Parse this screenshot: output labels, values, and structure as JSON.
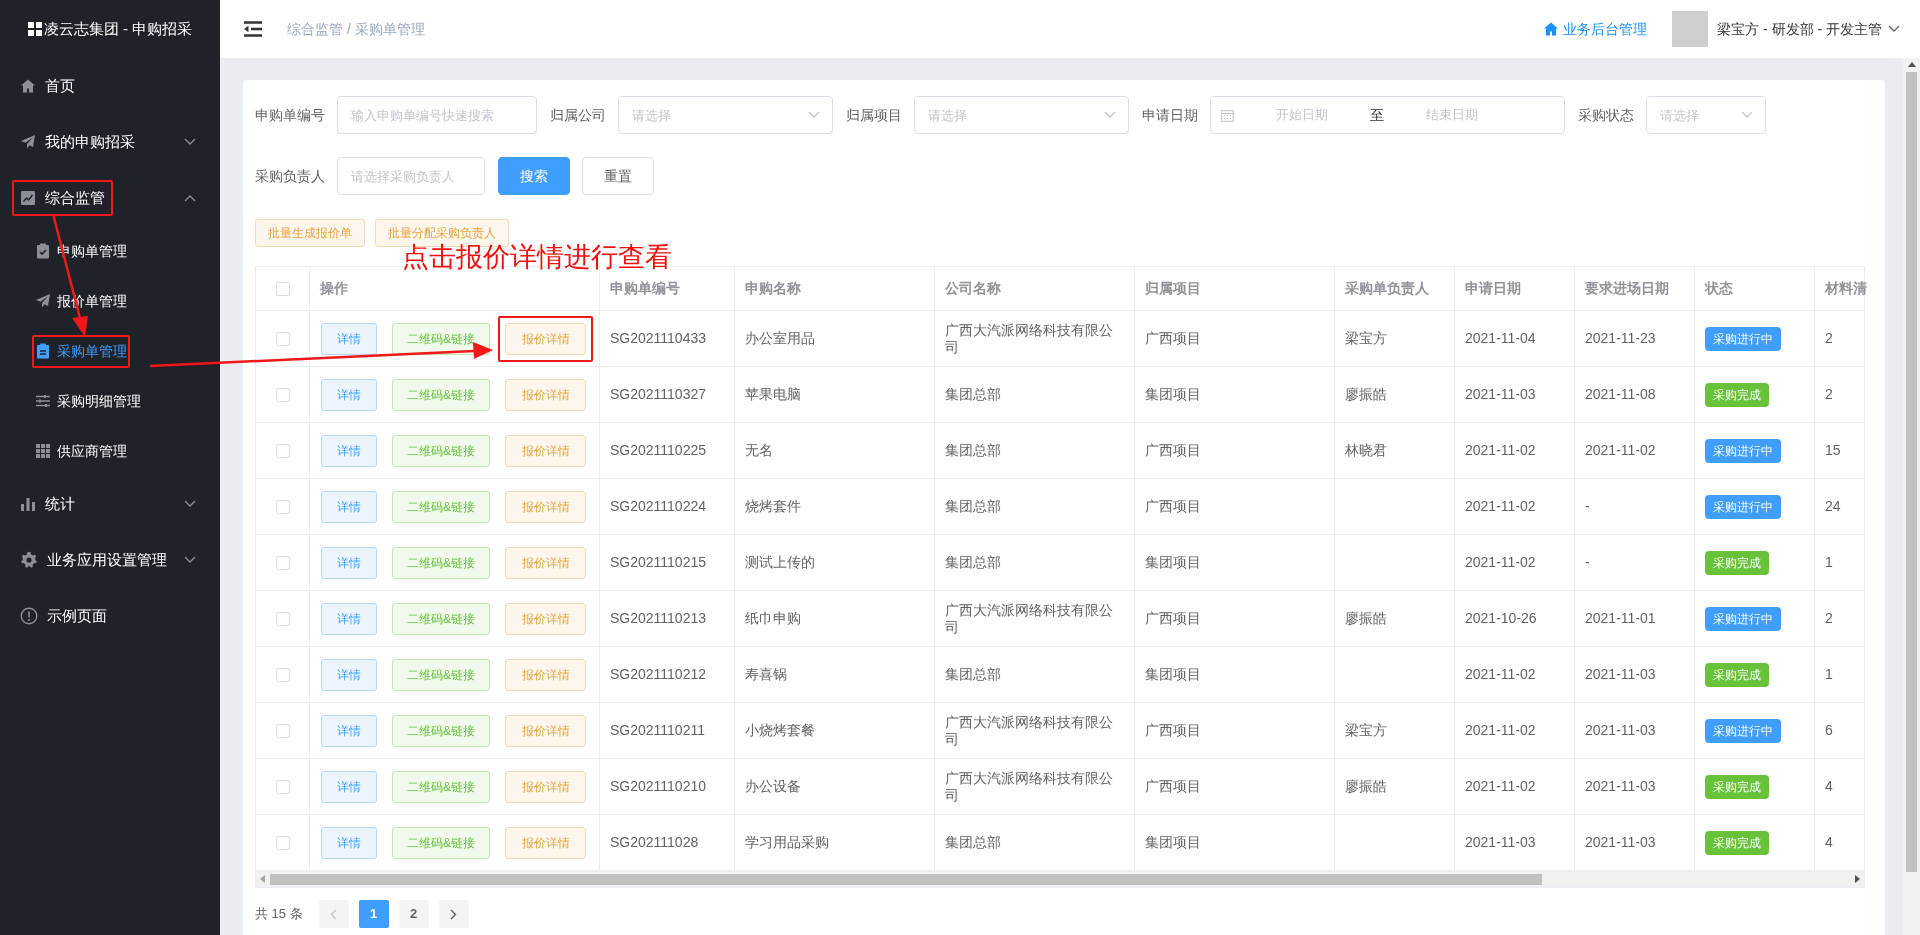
{
  "sidebar": {
    "logo": "凌云志集团 - 申购招采",
    "items": [
      {
        "label": "首页",
        "kind": "link",
        "highlighted": false
      },
      {
        "label": "我的申购招采",
        "kind": "group",
        "expanded": false,
        "highlighted": false
      },
      {
        "label": "综合监管",
        "kind": "group",
        "expanded": true,
        "highlighted": true,
        "children": [
          {
            "label": "申购单管理",
            "selected": false,
            "highlighted": false
          },
          {
            "label": "报价单管理",
            "selected": false,
            "highlighted": false
          },
          {
            "label": "采购单管理",
            "selected": true,
            "highlighted": true
          },
          {
            "label": "采购明细管理",
            "selected": false,
            "highlighted": false
          },
          {
            "label": "供应商管理",
            "selected": false,
            "highlighted": false
          }
        ]
      },
      {
        "label": "统计",
        "kind": "group",
        "expanded": false,
        "highlighted": false
      },
      {
        "label": "业务应用设置管理",
        "kind": "group",
        "expanded": false,
        "highlighted": false
      },
      {
        "label": "示例页面",
        "kind": "link",
        "highlighted": false
      }
    ]
  },
  "header": {
    "breadcrumb": "综合监管 / 采购单管理",
    "backend_link": "业务后台管理",
    "user": "梁宝方 - 研发部 - 开发主管"
  },
  "filters": [
    {
      "label": "申购单编号",
      "kind": "input",
      "placeholder": "输入申购单编号快速搜索"
    },
    {
      "label": "归属公司",
      "kind": "select",
      "placeholder": "请选择"
    },
    {
      "label": "归属项目",
      "kind": "select",
      "placeholder": "请选择"
    },
    {
      "label": "申请日期",
      "kind": "daterange",
      "start_placeholder": "开始日期",
      "separator": "至",
      "end_placeholder": "结束日期"
    },
    {
      "label": "采购状态",
      "kind": "select",
      "placeholder": "请选择"
    },
    {
      "label": "采购负责人",
      "kind": "input",
      "placeholder": "请选择采购负责人"
    }
  ],
  "filter_buttons": [
    {
      "label": "搜索",
      "kind": "primary"
    },
    {
      "label": "重置",
      "kind": "default"
    }
  ],
  "batch_buttons": [
    "批量生成报价单",
    "批量分配采购负责人"
  ],
  "annotation": {
    "text": "点击报价详情进行查看"
  },
  "table": {
    "all_checked": false,
    "columns": [
      "操作",
      "申购单编号",
      "申购名称",
      "公司名称",
      "归属项目",
      "采购单负责人",
      "申请日期",
      "要求进场日期",
      "状态",
      "材料清"
    ],
    "rows": [
      {
        "checked": false,
        "highlighted": true,
        "actions": [
          "详情",
          "二维码&链接",
          "报价详情"
        ],
        "id": "SG2021110433",
        "name": "办公室用品",
        "company": "广西大汽派网络科技有限公司",
        "project": "广西项目",
        "owner": "梁宝方",
        "apply_date": "2021-11-04",
        "due_date": "2021-11-23",
        "status": {
          "label": "采购进行中",
          "kind": "in_progress"
        },
        "materials": "2"
      },
      {
        "checked": false,
        "highlighted": false,
        "actions": [
          "详情",
          "二维码&链接",
          "报价详情"
        ],
        "id": "SG2021110327",
        "name": "苹果电脑",
        "company": "集团总部",
        "project": "集团项目",
        "owner": "廖振皓",
        "apply_date": "2021-11-03",
        "due_date": "2021-11-08",
        "status": {
          "label": "采购完成",
          "kind": "done"
        },
        "materials": "2"
      },
      {
        "checked": false,
        "highlighted": false,
        "actions": [
          "详情",
          "二维码&链接",
          "报价详情"
        ],
        "id": "SG2021110225",
        "name": "无名",
        "company": "集团总部",
        "project": "广西项目",
        "owner": "林晓君",
        "apply_date": "2021-11-02",
        "due_date": "2021-11-02",
        "status": {
          "label": "采购进行中",
          "kind": "in_progress"
        },
        "materials": "15"
      },
      {
        "checked": false,
        "highlighted": false,
        "actions": [
          "详情",
          "二维码&链接",
          "报价详情"
        ],
        "id": "SG2021110224",
        "name": "烧烤套件",
        "company": "集团总部",
        "project": "广西项目",
        "apply_date": "2021-11-02",
        "due_date": "-",
        "status": {
          "label": "采购进行中",
          "kind": "in_progress"
        },
        "materials": "24"
      },
      {
        "checked": false,
        "highlighted": false,
        "actions": [
          "详情",
          "二维码&链接",
          "报价详情"
        ],
        "id": "SG2021110215",
        "name": "测试上传的",
        "company": "集团总部",
        "project": "集团项目",
        "apply_date": "2021-11-02",
        "due_date": "-",
        "status": {
          "label": "采购完成",
          "kind": "done"
        },
        "materials": "1"
      },
      {
        "checked": false,
        "highlighted": false,
        "actions": [
          "详情",
          "二维码&链接",
          "报价详情"
        ],
        "id": "SG2021110213",
        "name": "纸巾申购",
        "company": "广西大汽派网络科技有限公司",
        "project": "广西项目",
        "owner": "廖振皓",
        "apply_date": "2021-10-26",
        "due_date": "2021-11-01",
        "status": {
          "label": "采购进行中",
          "kind": "in_progress"
        },
        "materials": "2"
      },
      {
        "checked": false,
        "highlighted": false,
        "actions": [
          "详情",
          "二维码&链接",
          "报价详情"
        ],
        "id": "SG2021110212",
        "name": "寿喜锅",
        "company": "集团总部",
        "project": "集团项目",
        "apply_date": "2021-11-02",
        "due_date": "2021-11-03",
        "status": {
          "label": "采购完成",
          "kind": "done"
        },
        "materials": "1"
      },
      {
        "checked": false,
        "highlighted": false,
        "actions": [
          "详情",
          "二维码&链接",
          "报价详情"
        ],
        "id": "SG2021110211",
        "name": "小烧烤套餐",
        "company": "广西大汽派网络科技有限公司",
        "project": "广西项目",
        "owner": "梁宝方",
        "apply_date": "2021-11-02",
        "due_date": "2021-11-03",
        "status": {
          "label": "采购进行中",
          "kind": "in_progress"
        },
        "materials": "6"
      },
      {
        "checked": false,
        "highlighted": false,
        "actions": [
          "详情",
          "二维码&链接",
          "报价详情"
        ],
        "id": "SG2021110210",
        "name": "办公设备",
        "company": "广西大汽派网络科技有限公司",
        "project": "广西项目",
        "owner": "廖振皓",
        "apply_date": "2021-11-02",
        "due_date": "2021-11-03",
        "status": {
          "label": "采购完成",
          "kind": "done"
        },
        "materials": "4"
      },
      {
        "checked": false,
        "highlighted": false,
        "actions": [
          "详情",
          "二维码&链接",
          "报价详情"
        ],
        "id": "SG202111028",
        "name": "学习用品采购",
        "company": "集团总部",
        "project": "集团项目",
        "apply_date": "2021-11-03",
        "due_date": "2021-11-03",
        "status": {
          "label": "采购完成",
          "kind": "done"
        },
        "materials": "4"
      }
    ]
  },
  "pagination": {
    "total": "共 15 条",
    "pages": [
      {
        "label": "1",
        "selected": true
      },
      {
        "label": "2",
        "selected": false
      }
    ]
  }
}
